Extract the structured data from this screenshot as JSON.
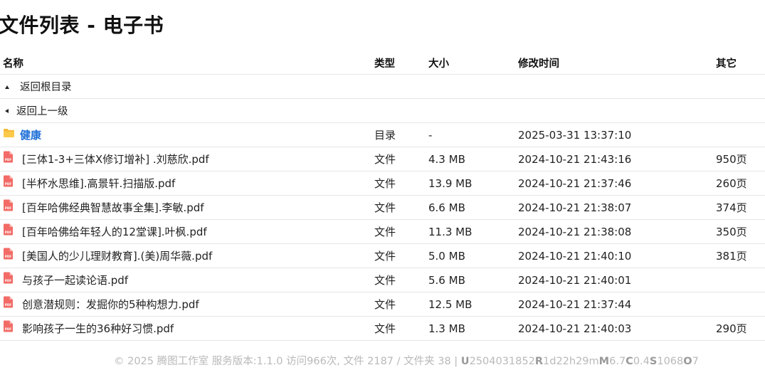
{
  "page_title": "文件列表 - 电子书",
  "columns": {
    "name": "名称",
    "type": "类型",
    "size": "大小",
    "modified": "修改时间",
    "other": "其它"
  },
  "nav": {
    "root": "返回根目录",
    "parent": "返回上一级"
  },
  "folders": [
    {
      "name": "健康",
      "type": "目录",
      "size": "-",
      "modified": "2025-03-31 13:37:10",
      "other": ""
    }
  ],
  "files": [
    {
      "name": "[三体1-3+三体X修订增补] .刘慈欣.pdf",
      "type": "文件",
      "size": "4.3 MB",
      "modified": "2024-10-21 21:43:16",
      "other": "950页"
    },
    {
      "name": "[半杯水思维].高景轩.扫描版.pdf",
      "type": "文件",
      "size": "13.9 MB",
      "modified": "2024-10-21 21:37:46",
      "other": "260页"
    },
    {
      "name": "[百年哈佛经典智慧故事全集].李敏.pdf",
      "type": "文件",
      "size": "6.6 MB",
      "modified": "2024-10-21 21:38:07",
      "other": "374页"
    },
    {
      "name": "[百年哈佛给年轻人的12堂课].叶枫.pdf",
      "type": "文件",
      "size": "11.3 MB",
      "modified": "2024-10-21 21:38:08",
      "other": "350页"
    },
    {
      "name": "[美国人的少儿理财教育].(美)周华薇.pdf",
      "type": "文件",
      "size": "5.0 MB",
      "modified": "2024-10-21 21:40:10",
      "other": "381页"
    },
    {
      "name": "与孩子一起读论语.pdf",
      "type": "文件",
      "size": "5.6 MB",
      "modified": "2024-10-21 21:40:01",
      "other": ""
    },
    {
      "name": "创意潜规则：发掘你的5种构想力.pdf",
      "type": "文件",
      "size": "12.5 MB",
      "modified": "2024-10-21 21:37:44",
      "other": ""
    },
    {
      "name": "影响孩子一生的36种好习惯.pdf",
      "type": "文件",
      "size": "1.3 MB",
      "modified": "2024-10-21 21:40:03",
      "other": "290页"
    }
  ],
  "footer": {
    "copyright": "© 2025 腾图工作室 服务版本:1.1.0 访问966次, 文件 2187 / 文件夹 38 | ",
    "stats": [
      {
        "k": "U",
        "v": "2504031852"
      },
      {
        "k": "R",
        "v": "1d22h29m"
      },
      {
        "k": "M",
        "v": "6.7"
      },
      {
        "k": "C",
        "v": "0.4"
      },
      {
        "k": "S",
        "v": "1068"
      },
      {
        "k": "O",
        "v": "7"
      }
    ]
  },
  "icons": {
    "folder": "folder-icon",
    "pdf": "pdf-icon",
    "up": "triangle-up-icon",
    "back": "triangle-left-icon"
  },
  "colors": {
    "link": "#1e6fd6",
    "folder": "#f5b93b",
    "pdf": "#e9534f",
    "footer": "#b9b9b9"
  }
}
